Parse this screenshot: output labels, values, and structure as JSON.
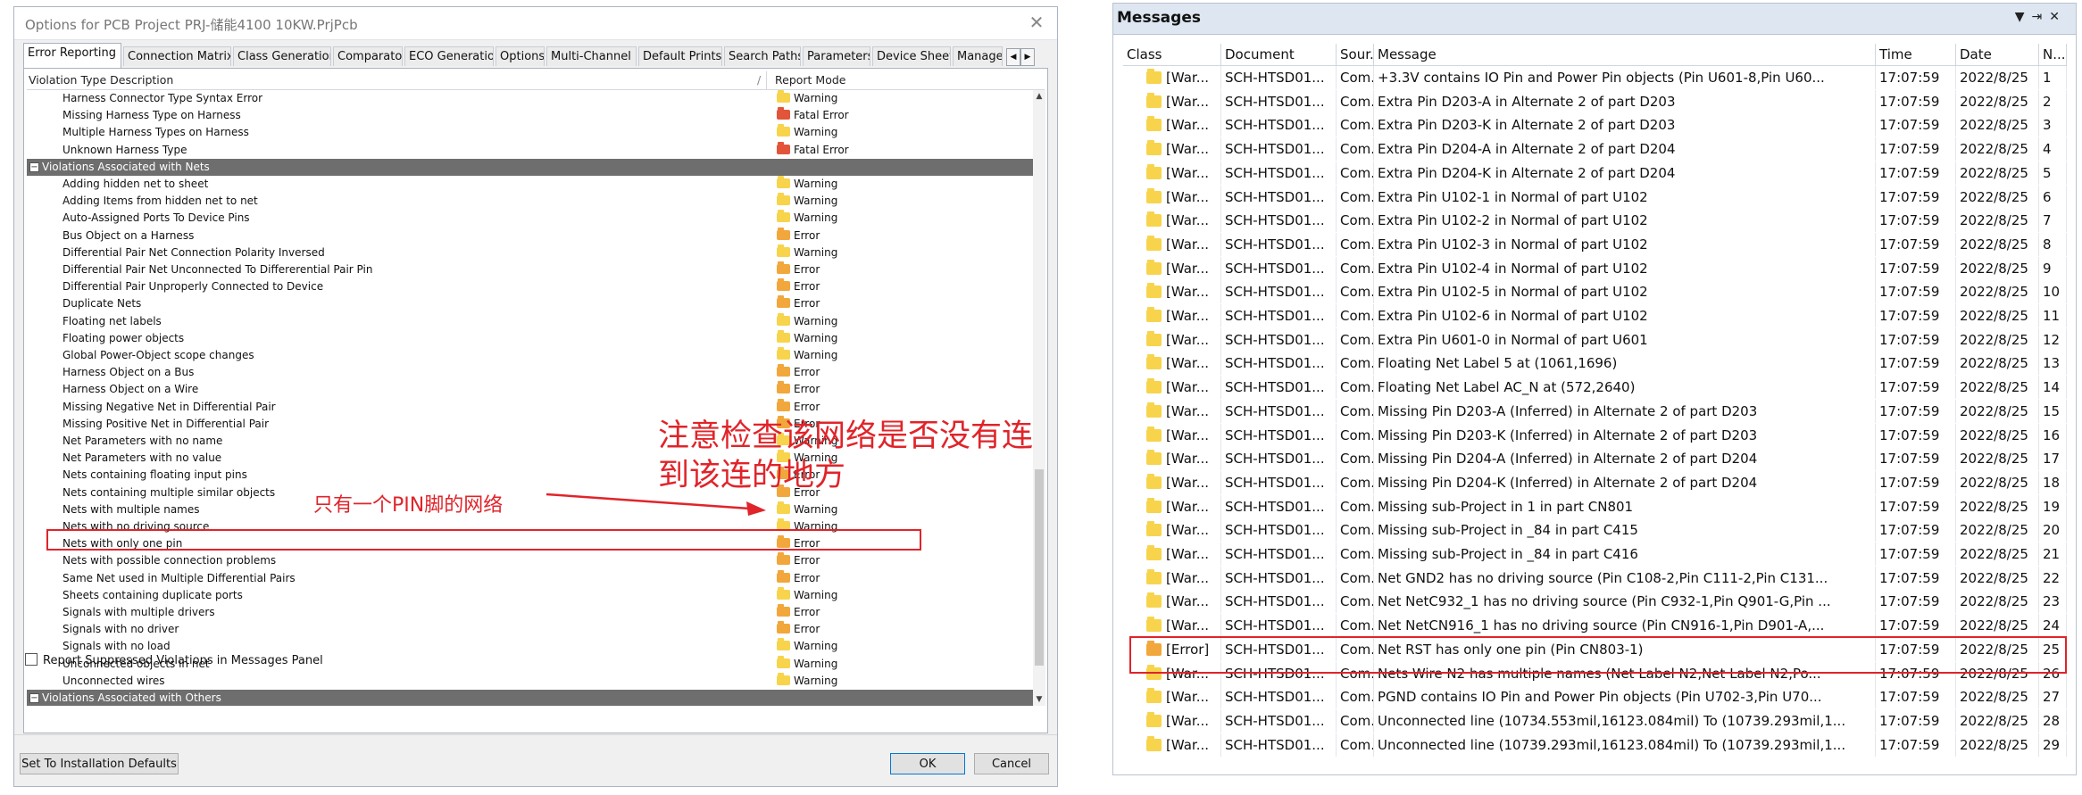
{
  "dialog": {
    "title": "Options for PCB Project PRJ-储能4100 10KW.PrjPcb",
    "close_glyph": "✕",
    "tabs": [
      "Error Reporting",
      "Connection Matrix",
      "Class Generation",
      "Comparator",
      "ECO Generation",
      "Options",
      "Multi-Channel",
      "Default Prints",
      "Search Paths",
      "Parameters",
      "Device Sheets",
      "Managed"
    ],
    "active_tab": 0,
    "grid_headers": {
      "description": "Violation Type Description",
      "sort_glyph": "/",
      "mode": "Report Mode"
    },
    "rows": [
      {
        "name": "Harness Connector Type Syntax Error",
        "mode": "Warning"
      },
      {
        "name": "Missing Harness Type on Harness",
        "mode": "Fatal Error"
      },
      {
        "name": "Multiple Harness Types on Harness",
        "mode": "Warning"
      },
      {
        "name": "Unknown Harness Type",
        "mode": "Fatal Error"
      },
      {
        "group": true,
        "name": "Violations Associated with Nets"
      },
      {
        "name": "Adding hidden net to sheet",
        "mode": "Warning"
      },
      {
        "name": "Adding Items from hidden net to net",
        "mode": "Warning"
      },
      {
        "name": "Auto-Assigned Ports To Device Pins",
        "mode": "Warning"
      },
      {
        "name": "Bus Object on a Harness",
        "mode": "Error"
      },
      {
        "name": "Differential Pair Net Connection Polarity Inversed",
        "mode": "Warning"
      },
      {
        "name": "Differential Pair Net Unconnected To Differerential Pair Pin",
        "mode": "Error"
      },
      {
        "name": "Differential Pair Unproperly Connected to Device",
        "mode": "Error"
      },
      {
        "name": "Duplicate Nets",
        "mode": "Error"
      },
      {
        "name": "Floating net labels",
        "mode": "Warning"
      },
      {
        "name": "Floating power objects",
        "mode": "Warning"
      },
      {
        "name": "Global Power-Object scope changes",
        "mode": "Warning"
      },
      {
        "name": "Harness Object on a Bus",
        "mode": "Error"
      },
      {
        "name": "Harness Object on a Wire",
        "mode": "Error"
      },
      {
        "name": "Missing Negative Net in Differential Pair",
        "mode": "Error"
      },
      {
        "name": "Missing Positive Net in Differential Pair",
        "mode": "Error"
      },
      {
        "name": "Net Parameters with no name",
        "mode": "Warning"
      },
      {
        "name": "Net Parameters with no value",
        "mode": "Warning"
      },
      {
        "name": "Nets containing floating input pins",
        "mode": "Error"
      },
      {
        "name": "Nets containing multiple similar objects",
        "mode": "Error"
      },
      {
        "name": "Nets with multiple names",
        "mode": "Warning"
      },
      {
        "name": "Nets with no driving source",
        "mode": "Warning"
      },
      {
        "name": "Nets with only one pin",
        "mode": "Error"
      },
      {
        "name": "Nets with possible connection problems",
        "mode": "Error"
      },
      {
        "name": "Same Net used in Multiple Differential Pairs",
        "mode": "Error"
      },
      {
        "name": "Sheets containing duplicate ports",
        "mode": "Warning"
      },
      {
        "name": "Signals with multiple drivers",
        "mode": "Error"
      },
      {
        "name": "Signals with no driver",
        "mode": "Error"
      },
      {
        "name": "Signals with no load",
        "mode": "Warning"
      },
      {
        "name": "Unconnected objects in net",
        "mode": "Warning"
      },
      {
        "name": "Unconnected wires",
        "mode": "Warning"
      },
      {
        "group": true,
        "name": "Violations Associated with Others"
      }
    ],
    "report_suppressed_label": "Report Suppressed Violations in Messages Panel",
    "buttons": {
      "defaults": "Set To Installation Defaults",
      "ok": "OK",
      "cancel": "Cancel"
    }
  },
  "annotations": {
    "left_label": "只有一个PIN脚的网络",
    "right_label_line1": "注意检查该网络是否没有连",
    "right_label_line2": "到该连的地方"
  },
  "mode_colors": {
    "Warning": "#f7d44c",
    "Error": "#f1a73b",
    "Fatal Error": "#e2553a"
  },
  "messages": {
    "title": "Messages",
    "controls": [
      "▼",
      "⇥",
      "✕"
    ],
    "headers": [
      "Class",
      "Document",
      "Sour...",
      "Message",
      "Time",
      "Date",
      "N..."
    ],
    "rows": [
      {
        "cls": "[War...",
        "doc": "SCH-HTSD01...",
        "src": "Com...",
        "msg": "+3.3V contains IO Pin and Power Pin objects (Pin U601-8,Pin U60...",
        "time": "17:07:59",
        "date": "2022/8/25",
        "n": "1"
      },
      {
        "cls": "[War...",
        "doc": "SCH-HTSD01...",
        "src": "Com...",
        "msg": "Extra Pin D203-A in Alternate 2 of part D203",
        "time": "17:07:59",
        "date": "2022/8/25",
        "n": "2"
      },
      {
        "cls": "[War...",
        "doc": "SCH-HTSD01...",
        "src": "Com...",
        "msg": "Extra Pin D203-K in Alternate 2 of part D203",
        "time": "17:07:59",
        "date": "2022/8/25",
        "n": "3"
      },
      {
        "cls": "[War...",
        "doc": "SCH-HTSD01...",
        "src": "Com...",
        "msg": "Extra Pin D204-A in Alternate 2 of part D204",
        "time": "17:07:59",
        "date": "2022/8/25",
        "n": "4"
      },
      {
        "cls": "[War...",
        "doc": "SCH-HTSD01...",
        "src": "Com...",
        "msg": "Extra Pin D204-K in Alternate 2 of part D204",
        "time": "17:07:59",
        "date": "2022/8/25",
        "n": "5"
      },
      {
        "cls": "[War...",
        "doc": "SCH-HTSD01...",
        "src": "Com...",
        "msg": "Extra Pin U102-1 in Normal of part U102",
        "time": "17:07:59",
        "date": "2022/8/25",
        "n": "6"
      },
      {
        "cls": "[War...",
        "doc": "SCH-HTSD01...",
        "src": "Com...",
        "msg": "Extra Pin U102-2 in Normal of part U102",
        "time": "17:07:59",
        "date": "2022/8/25",
        "n": "7"
      },
      {
        "cls": "[War...",
        "doc": "SCH-HTSD01...",
        "src": "Com...",
        "msg": "Extra Pin U102-3 in Normal of part U102",
        "time": "17:07:59",
        "date": "2022/8/25",
        "n": "8"
      },
      {
        "cls": "[War...",
        "doc": "SCH-HTSD01...",
        "src": "Com...",
        "msg": "Extra Pin U102-4 in Normal of part U102",
        "time": "17:07:59",
        "date": "2022/8/25",
        "n": "9"
      },
      {
        "cls": "[War...",
        "doc": "SCH-HTSD01...",
        "src": "Com...",
        "msg": "Extra Pin U102-5 in Normal of part U102",
        "time": "17:07:59",
        "date": "2022/8/25",
        "n": "10"
      },
      {
        "cls": "[War...",
        "doc": "SCH-HTSD01...",
        "src": "Com...",
        "msg": "Extra Pin U102-6 in Normal of part U102",
        "time": "17:07:59",
        "date": "2022/8/25",
        "n": "11"
      },
      {
        "cls": "[War...",
        "doc": "SCH-HTSD01...",
        "src": "Com...",
        "msg": "Extra Pin U601-0 in Normal of part U601",
        "time": "17:07:59",
        "date": "2022/8/25",
        "n": "12"
      },
      {
        "cls": "[War...",
        "doc": "SCH-HTSD01...",
        "src": "Com...",
        "msg": "Floating Net Label 5 at (1061,1696)",
        "time": "17:07:59",
        "date": "2022/8/25",
        "n": "13"
      },
      {
        "cls": "[War...",
        "doc": "SCH-HTSD01...",
        "src": "Com...",
        "msg": "Floating Net Label AC_N at (572,2640)",
        "time": "17:07:59",
        "date": "2022/8/25",
        "n": "14"
      },
      {
        "cls": "[War...",
        "doc": "SCH-HTSD01...",
        "src": "Com...",
        "msg": "Missing Pin D203-A (Inferred) in Alternate 2 of part D203",
        "time": "17:07:59",
        "date": "2022/8/25",
        "n": "15"
      },
      {
        "cls": "[War...",
        "doc": "SCH-HTSD01...",
        "src": "Com...",
        "msg": "Missing Pin D203-K (Inferred) in Alternate 2 of part D203",
        "time": "17:07:59",
        "date": "2022/8/25",
        "n": "16"
      },
      {
        "cls": "[War...",
        "doc": "SCH-HTSD01...",
        "src": "Com...",
        "msg": "Missing Pin D204-A (Inferred) in Alternate 2 of part D204",
        "time": "17:07:59",
        "date": "2022/8/25",
        "n": "17"
      },
      {
        "cls": "[War...",
        "doc": "SCH-HTSD01...",
        "src": "Com...",
        "msg": "Missing Pin D204-K (Inferred) in Alternate 2 of part D204",
        "time": "17:07:59",
        "date": "2022/8/25",
        "n": "18"
      },
      {
        "cls": "[War...",
        "doc": "SCH-HTSD01...",
        "src": "Com...",
        "msg": "Missing sub-Project in 1 in part CN801",
        "time": "17:07:59",
        "date": "2022/8/25",
        "n": "19"
      },
      {
        "cls": "[War...",
        "doc": "SCH-HTSD01...",
        "src": "Com...",
        "msg": "Missing sub-Project in _84 in part C415",
        "time": "17:07:59",
        "date": "2022/8/25",
        "n": "20"
      },
      {
        "cls": "[War...",
        "doc": "SCH-HTSD01...",
        "src": "Com...",
        "msg": "Missing sub-Project in _84 in part C416",
        "time": "17:07:59",
        "date": "2022/8/25",
        "n": "21"
      },
      {
        "cls": "[War...",
        "doc": "SCH-HTSD01...",
        "src": "Com...",
        "msg": "Net GND2 has no driving source (Pin C108-2,Pin C111-2,Pin C131...",
        "time": "17:07:59",
        "date": "2022/8/25",
        "n": "22"
      },
      {
        "cls": "[War...",
        "doc": "SCH-HTSD01...",
        "src": "Com...",
        "msg": "Net NetC932_1 has no driving source (Pin C932-1,Pin Q901-G,Pin ...",
        "time": "17:07:59",
        "date": "2022/8/25",
        "n": "23"
      },
      {
        "cls": "[War...",
        "doc": "SCH-HTSD01...",
        "src": "Com...",
        "msg": "Net NetCN916_1 has no driving source (Pin CN916-1,Pin D901-A,...",
        "time": "17:07:59",
        "date": "2022/8/25",
        "n": "24"
      },
      {
        "cls": "[Error]",
        "doc": "SCH-HTSD01...",
        "src": "Com...",
        "msg": "Net RST has only one pin (Pin CN803-1)",
        "time": "17:07:59",
        "date": "2022/8/25",
        "n": "25",
        "error": true
      },
      {
        "cls": "[War...",
        "doc": "SCH-HTSD01...",
        "src": "Com...",
        "msg": "Nets Wire N2 has multiple names (Net Label N2,Net Label N2,Po...",
        "time": "17:07:59",
        "date": "2022/8/25",
        "n": "26"
      },
      {
        "cls": "[War...",
        "doc": "SCH-HTSD01...",
        "src": "Com...",
        "msg": "PGND contains IO Pin and Power Pin objects (Pin U702-3,Pin U70...",
        "time": "17:07:59",
        "date": "2022/8/25",
        "n": "27"
      },
      {
        "cls": "[War...",
        "doc": "SCH-HTSD01...",
        "src": "Com...",
        "msg": "Unconnected line (10734.553mil,16123.084mil) To (10739.293mil,1...",
        "time": "17:07:59",
        "date": "2022/8/25",
        "n": "28"
      },
      {
        "cls": "[War...",
        "doc": "SCH-HTSD01...",
        "src": "Com...",
        "msg": "Unconnected line (10739.293mil,16123.084mil) To (10739.293mil,1...",
        "time": "17:07:59",
        "date": "2022/8/25",
        "n": "29"
      }
    ]
  }
}
